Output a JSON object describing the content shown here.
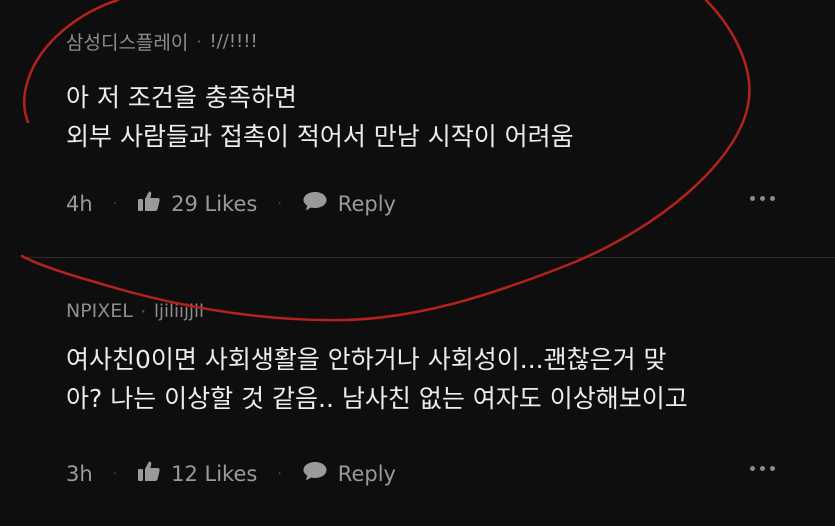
{
  "comments": [
    {
      "author": "삼성디스플레이",
      "separator": "·",
      "flair": "!//!!!!",
      "body_lines": [
        "아 저 조건을 충족하면",
        "외부 사람들과 접촉이 적어서 만남 시작이 어려움"
      ],
      "time": "4h",
      "likes": "29 Likes",
      "reply": "Reply"
    },
    {
      "author": "NPIXEL",
      "separator": "·",
      "flair": "ljiliijjll",
      "body_lines": [
        "여사친0이면 사회생활을 안하거나 사회성이...괜찮은거 맞",
        "아? 나는 이상할 것 같음.. 남사친 없는 여자도 이상해보이고"
      ],
      "time": "3h",
      "likes": "12 Likes",
      "reply": "Reply"
    }
  ],
  "colors": {
    "background": "#0e0e0f",
    "annotation_stroke": "#b3221d"
  },
  "icons": [
    "thumbs-up-icon",
    "speech-bubble-icon",
    "more-dots-icon"
  ]
}
